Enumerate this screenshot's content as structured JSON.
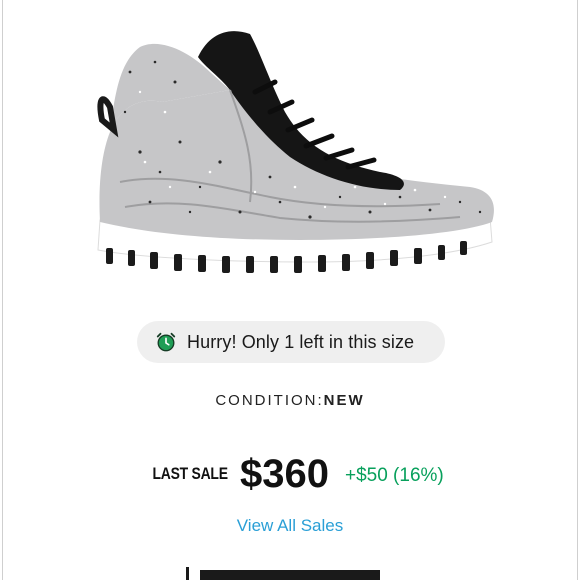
{
  "product": {
    "image_alt": "gray speckled high-top sneaker",
    "colors": {
      "upper": "#c6c6c8",
      "collar": "#151515",
      "sole": "#ffffff",
      "speckle_dark": "#2a2a2a"
    }
  },
  "urgency": {
    "icon": "alarm-clock-icon",
    "text": "Hurry! Only 1 left in this size"
  },
  "condition": {
    "label": "CONDITION:",
    "value": "NEW"
  },
  "sale": {
    "label": "LAST SALE",
    "price": "$360",
    "change": "+$50 (16%)",
    "change_color": "#08a05c"
  },
  "links": {
    "view_all_sales": "View All Sales",
    "link_color": "#2a9fd6"
  }
}
